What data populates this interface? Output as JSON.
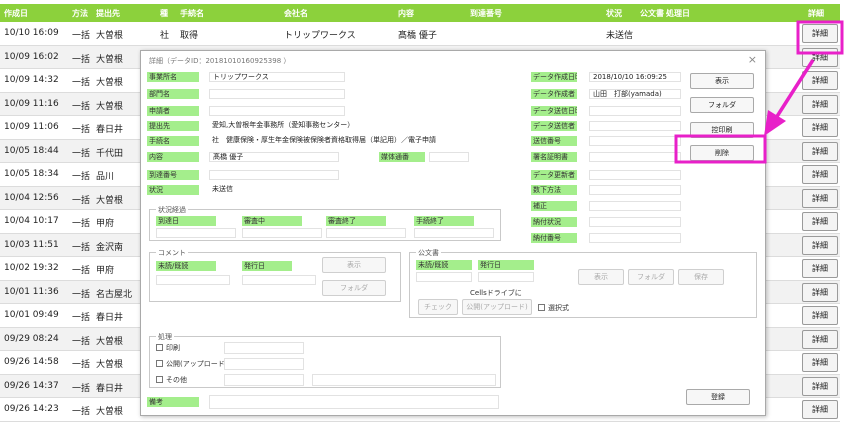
{
  "grid": {
    "headers": [
      "作成日",
      "方法",
      "提出先",
      "種",
      "手続名",
      "会社名",
      "内容",
      "到達番号",
      "状況",
      "公文書",
      "処理日",
      "詳細"
    ],
    "first_row": {
      "date": "10/10 16:09",
      "method": "一括",
      "dest": "大曽根",
      "kind": "社",
      "procedure": "取得",
      "company": "トリップワークス",
      "content": "髙橋 優子",
      "status": "未送信"
    },
    "rows": [
      {
        "date": "10/09 16:02",
        "method": "一括",
        "dest": "大曽根"
      },
      {
        "date": "10/09 14:32",
        "method": "一括",
        "dest": "大曽根"
      },
      {
        "date": "10/09 11:16",
        "method": "一括",
        "dest": "大曽根"
      },
      {
        "date": "10/09 11:06",
        "method": "一括",
        "dest": "春日井"
      },
      {
        "date": "10/05 18:44",
        "method": "一括",
        "dest": "千代田"
      },
      {
        "date": "10/05 18:34",
        "method": "一括",
        "dest": "品川"
      },
      {
        "date": "10/04 12:56",
        "method": "一括",
        "dest": "大曽根"
      },
      {
        "date": "10/04 10:17",
        "method": "一括",
        "dest": "甲府"
      },
      {
        "date": "10/03 11:51",
        "method": "一括",
        "dest": "金沢南"
      },
      {
        "date": "10/02 19:32",
        "method": "一括",
        "dest": "甲府"
      },
      {
        "date": "10/01 11:36",
        "method": "一括",
        "dest": "名古屋北"
      },
      {
        "date": "10/01 09:49",
        "method": "一括",
        "dest": "春日井"
      },
      {
        "date": "09/29 08:24",
        "method": "一括",
        "dest": "大曽根"
      },
      {
        "date": "09/26 14:58",
        "method": "一括",
        "dest": "大曽根"
      },
      {
        "date": "09/26 14:37",
        "method": "一括",
        "dest": "春日井"
      },
      {
        "date": "09/26 14:23",
        "method": "一括",
        "dest": "大曽根"
      }
    ],
    "detail_label": "詳細"
  },
  "dialog": {
    "title": "詳細（データID：20181010160925398 ）",
    "close": "×",
    "fields": {
      "office_label": "事業所名",
      "office_value": "トリップワークス",
      "dept_label": "部門名",
      "applicant_label": "申請者",
      "dest_label": "提出先",
      "dest_value": "愛知,大曽根年金事務所（愛知事務センター）",
      "proc_label": "手続名",
      "proc_value": "社　健康保険・厚生年金保険被保険者資格取得届（単記用）／電子申請",
      "content_label": "内容",
      "content_value": "髙橋 優子",
      "media_label": "媒体通番",
      "arrival_label": "到達番号",
      "status_label": "状況",
      "status_value": "未送信",
      "created_label": "データ作成日時",
      "created_value": "2018/10/10 16:09:25",
      "creator_label": "データ作成者",
      "creator_value": "山田　打部(yamada)",
      "sent_date_label": "データ送信日時",
      "sender_label": "データ送信者",
      "send_no_label": "送信番号",
      "cert_label": "署名証明書",
      "updated_label": "データ更新者",
      "submit_method_label": "数下方法",
      "correction_label": "補正",
      "payment_status_label": "納付状況",
      "payment_no_label": "納付番号"
    },
    "buttons": {
      "display": "表示",
      "folder": "フォルダ",
      "print": "控印刷",
      "delete": "削除",
      "register": "登録"
    },
    "status_history": {
      "title": "状況経過",
      "arrival_date": "到達日",
      "reviewing": "審査中",
      "review_done": "審査終了",
      "proc_done": "手続終了"
    },
    "comment": {
      "title": "コメント",
      "unread": "未読/既読",
      "issue_date": "発行日",
      "display": "表示",
      "folder": "フォルダ"
    },
    "official": {
      "title": "公文書",
      "unread": "未読/既読",
      "issue_date": "発行日",
      "display": "表示",
      "folder": "フォルダ",
      "save": "保存",
      "cells_drive": "Cellsドライブに",
      "check": "チェック",
      "public_upload": "公開(アップロード)",
      "select": "選択式"
    },
    "processing": {
      "title": "処理",
      "print": "印刷",
      "public_upload": "公開(アップロード)",
      "other": "その他"
    },
    "remarks_label": "備考"
  }
}
